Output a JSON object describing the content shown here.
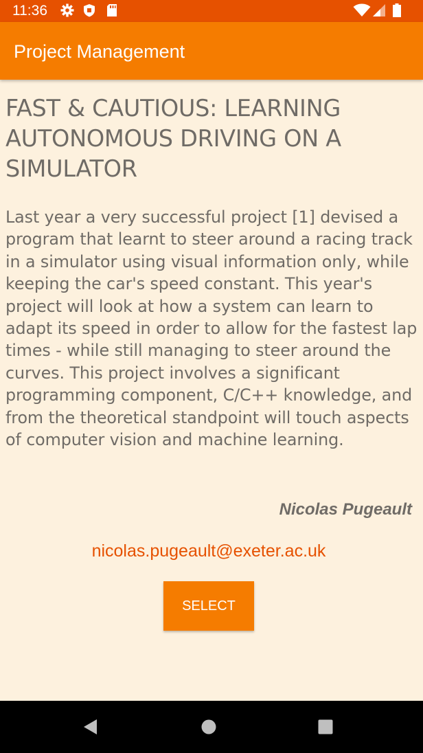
{
  "status_bar": {
    "time": "11:36",
    "background_color": "#E65100",
    "left_icons": [
      "gear-icon",
      "shield-icon",
      "sd-card-icon"
    ],
    "right_icons": [
      "wifi-icon",
      "cell-signal-icon",
      "battery-icon"
    ]
  },
  "app_bar": {
    "title": "Project Management",
    "background_color": "#F57C00"
  },
  "project": {
    "title": "FAST & CAUTIOUS: LEARNING AUTONOMOUS DRIVING ON A SIMULATOR",
    "description": "Last year a very successful project [1] devised a program that learnt to steer around a racing track in a simulator using visual information only, while keeping the car's speed constant. This year's project will look at how a system can learn to adapt its speed in order to allow for the fastest lap times - while still managing to steer around the curves. This project involves a significant programming component, C/C++ knowledge, and from the theoretical standpoint will touch aspects of computer vision and machine learning.",
    "supervisor": "Nicolas Pugeault",
    "email": "nicolas.pugeault@exeter.ac.uk",
    "select_label": "SELECT"
  },
  "nav_bar": {
    "buttons": [
      "back-icon",
      "home-icon",
      "recents-icon"
    ]
  },
  "colors": {
    "page_background": "#FDF1DE",
    "text": "#6F6B66",
    "accent": "#F57C00",
    "link": "#E65100"
  }
}
